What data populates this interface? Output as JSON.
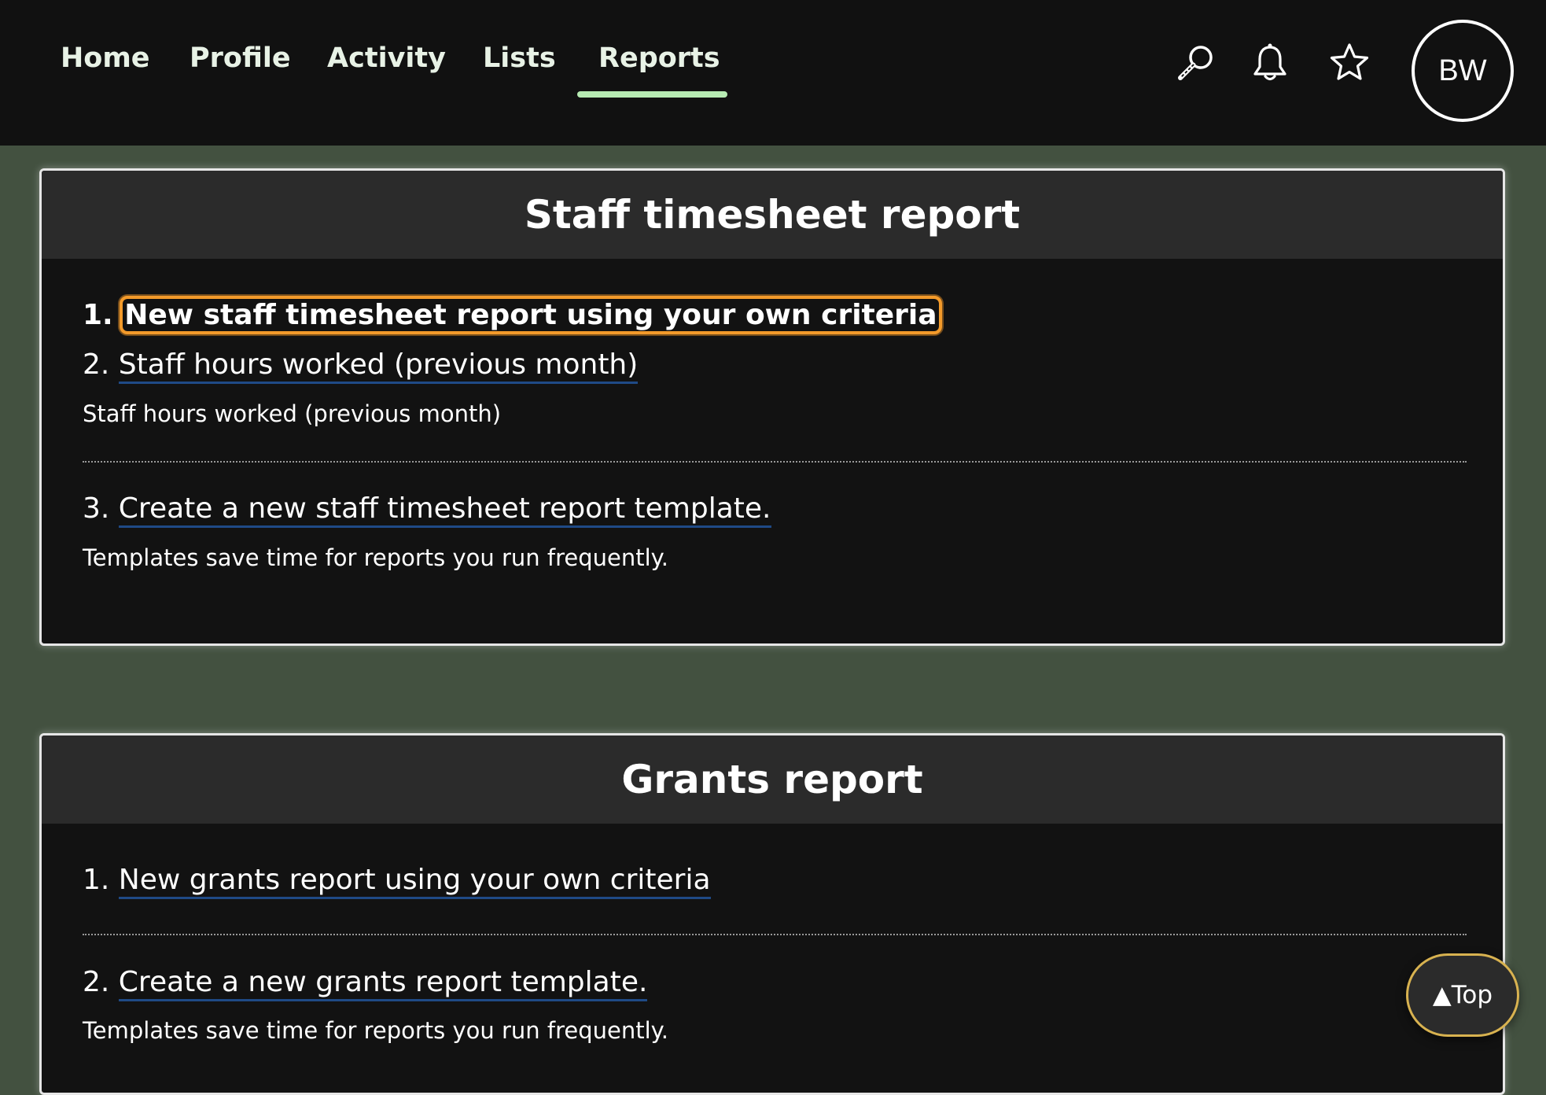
{
  "nav": {
    "tabs": [
      {
        "label": "Home"
      },
      {
        "label": "Profile"
      },
      {
        "label": "Activity"
      },
      {
        "label": "Lists"
      },
      {
        "label": "Reports",
        "active": true
      }
    ],
    "active_underline_color": "#b6eab2",
    "icons": [
      "search-icon",
      "bell-icon",
      "star-icon"
    ],
    "avatar_initials": "BW"
  },
  "panels": [
    {
      "title": "Staff timesheet report",
      "items": [
        {
          "number": "1.",
          "label": "New staff timesheet report using your own criteria",
          "focused": true
        },
        {
          "number": "2.",
          "label": "Staff hours worked (previous month)",
          "description": "Staff hours worked (previous month)"
        },
        {
          "number": "3.",
          "label": "Create a new staff timesheet report template.",
          "description": "Templates save time for reports you run frequently."
        }
      ]
    },
    {
      "title": "Grants report",
      "items": [
        {
          "number": "1.",
          "label": "New grants report using your own criteria"
        },
        {
          "number": "2.",
          "label": "Create a new grants report template.",
          "description": "Templates save time for reports you run frequently."
        }
      ]
    }
  ],
  "back_to_top": {
    "label": "▲Top"
  },
  "colors": {
    "page_background": "#435140",
    "topbar": "#111111",
    "panel_background": "#121212",
    "panel_header": "#2b2b2b",
    "focus_outline": "#f39a2a",
    "link_underline": "#1f4a86",
    "top_button_border": "#d8b250"
  }
}
